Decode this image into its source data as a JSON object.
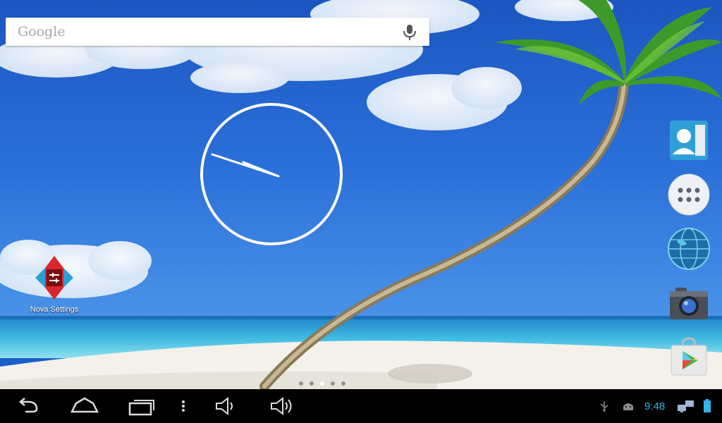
{
  "search": {
    "logo_text": "Google"
  },
  "clock": {
    "hour_angle": 292,
    "minute_angle": 288
  },
  "desktop": {
    "icons": [
      {
        "label": "Nova Settings",
        "icon": "nova-settings-icon"
      }
    ]
  },
  "dock": {
    "items": [
      {
        "icon": "contacts-icon"
      },
      {
        "icon": "app-drawer-icon"
      },
      {
        "icon": "browser-globe-icon"
      },
      {
        "icon": "camera-icon"
      },
      {
        "icon": "play-store-icon"
      }
    ]
  },
  "pager": {
    "count": 5,
    "active_index": 2
  },
  "navbar": {
    "buttons": [
      "back-icon",
      "home-icon",
      "recent-apps-icon",
      "menu-icon",
      "volume-down-icon",
      "volume-up-icon"
    ]
  },
  "status": {
    "time": "9:48",
    "time_color": "#33b5e5",
    "icons": [
      "usb-icon",
      "android-debug-icon",
      "network-icon",
      "battery-icon"
    ]
  }
}
